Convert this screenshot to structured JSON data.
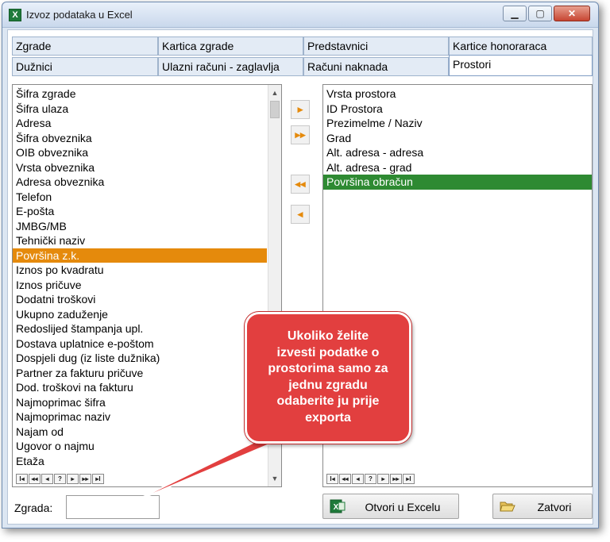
{
  "window": {
    "title": "Izvoz podataka u Excel"
  },
  "tabs": [
    "Zgrade",
    "Kartica zgrade",
    "Predstavnici",
    "Kartice honoraraca",
    "Dužnici",
    "Ulazni računi - zaglavlja",
    "Računi naknada",
    "Prostori"
  ],
  "left_list": {
    "items": [
      "Šifra zgrade",
      "Šifra ulaza",
      "Adresa",
      "Šifra obveznika",
      "OIB obveznika",
      "Vrsta obveznika",
      "Adresa obveznika",
      "Telefon",
      "E-pošta",
      "JMBG/MB",
      "Tehnički naziv",
      "Površina z.k.",
      "Iznos po kvadratu",
      "Iznos pričuve",
      "Dodatni troškovi",
      "Ukupno zaduženje",
      "Redoslijed štampanja upl.",
      "Dostava uplatnice e-poštom",
      "Dospjeli dug (iz liste dužnika)",
      "Partner za fakturu pričuve",
      "Dod. troškovi na fakturu",
      "Najmoprimac šifra",
      "Najmoprimac naziv",
      "Najam od",
      "Ugovor o najmu",
      "Etaža"
    ],
    "selected": "Površina z.k."
  },
  "right_list": {
    "items": [
      "Vrsta prostora",
      "ID Prostora",
      "Prezimelme / Naziv",
      "Grad",
      "Alt. adresa - adresa",
      "Alt. adresa - grad",
      "Površina obračun"
    ],
    "selected": "Površina obračun"
  },
  "nav_buttons": [
    "I◂",
    "◂◂",
    "◂",
    "?",
    "▸",
    "▸▸",
    "▸I"
  ],
  "move_buttons": [
    "add-one",
    "add-all",
    "remove-all",
    "remove-one"
  ],
  "zgrada": {
    "label": "Zgrada:",
    "value": ""
  },
  "buttons": {
    "open_excel": "Otvori u Excelu",
    "close": "Zatvori"
  },
  "callout": {
    "lines": [
      "Ukoliko želite",
      "izvesti podatke o",
      "prostorima samo za",
      "jednu zgradu",
      "odaberite ju prije",
      "exporta"
    ]
  },
  "colors": {
    "selection_orange": "#e58a0c",
    "selection_green": "#2e8a32",
    "callout_red": "#e23f3f"
  }
}
